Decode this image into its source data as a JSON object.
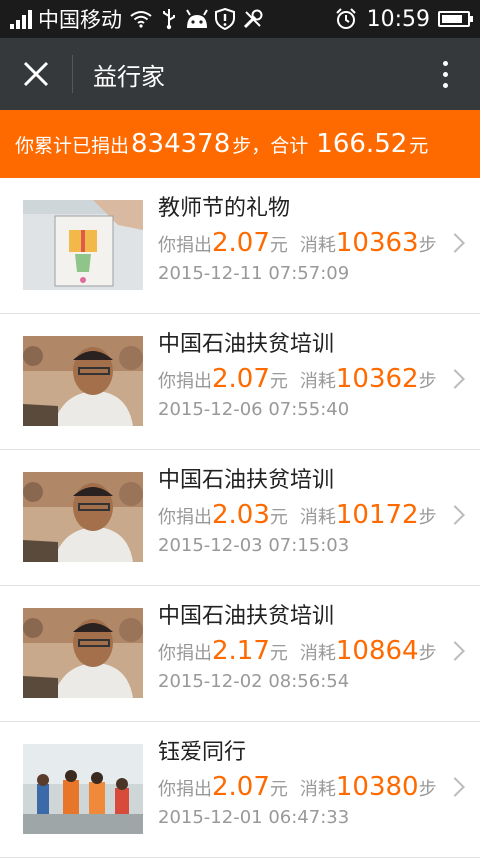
{
  "status_bar": {
    "carrier": "中国移动",
    "time": "10:59",
    "icons": [
      "signal-icon",
      "wifi-icon",
      "usb-icon",
      "android-icon",
      "shield-alert-icon",
      "tools-icon",
      "alarm-clock-icon",
      "battery-icon"
    ],
    "battery_level": 0.85
  },
  "header": {
    "title": "益行家",
    "close_icon": "close-icon",
    "more_icon": "more-vertical-icon"
  },
  "summary": {
    "prefix": "你累计已捐出",
    "steps": "834378",
    "steps_unit": "步，合计",
    "amount": "166.52",
    "amount_unit": "元"
  },
  "labels": {
    "donated": "你捐出",
    "yuan": "元",
    "consumed": "消耗",
    "steps": "步"
  },
  "items": [
    {
      "title": "教师节的礼物",
      "amount": "2.07",
      "steps": "10363",
      "date": "2015-12-11 07:57:09",
      "image": "gift-box-photo"
    },
    {
      "title": "中国石油扶贫培训",
      "amount": "2.07",
      "steps": "10362",
      "date": "2015-12-06 07:55:40",
      "image": "classroom-man-photo"
    },
    {
      "title": "中国石油扶贫培训",
      "amount": "2.03",
      "steps": "10172",
      "date": "2015-12-03 07:15:03",
      "image": "classroom-man-photo"
    },
    {
      "title": "中国石油扶贫培训",
      "amount": "2.17",
      "steps": "10864",
      "date": "2015-12-02 08:56:54",
      "image": "classroom-man-photo"
    },
    {
      "title": "钰爱同行",
      "amount": "2.07",
      "steps": "10380",
      "date": "2015-12-01 06:47:33",
      "image": "children-activity-photo"
    }
  ]
}
